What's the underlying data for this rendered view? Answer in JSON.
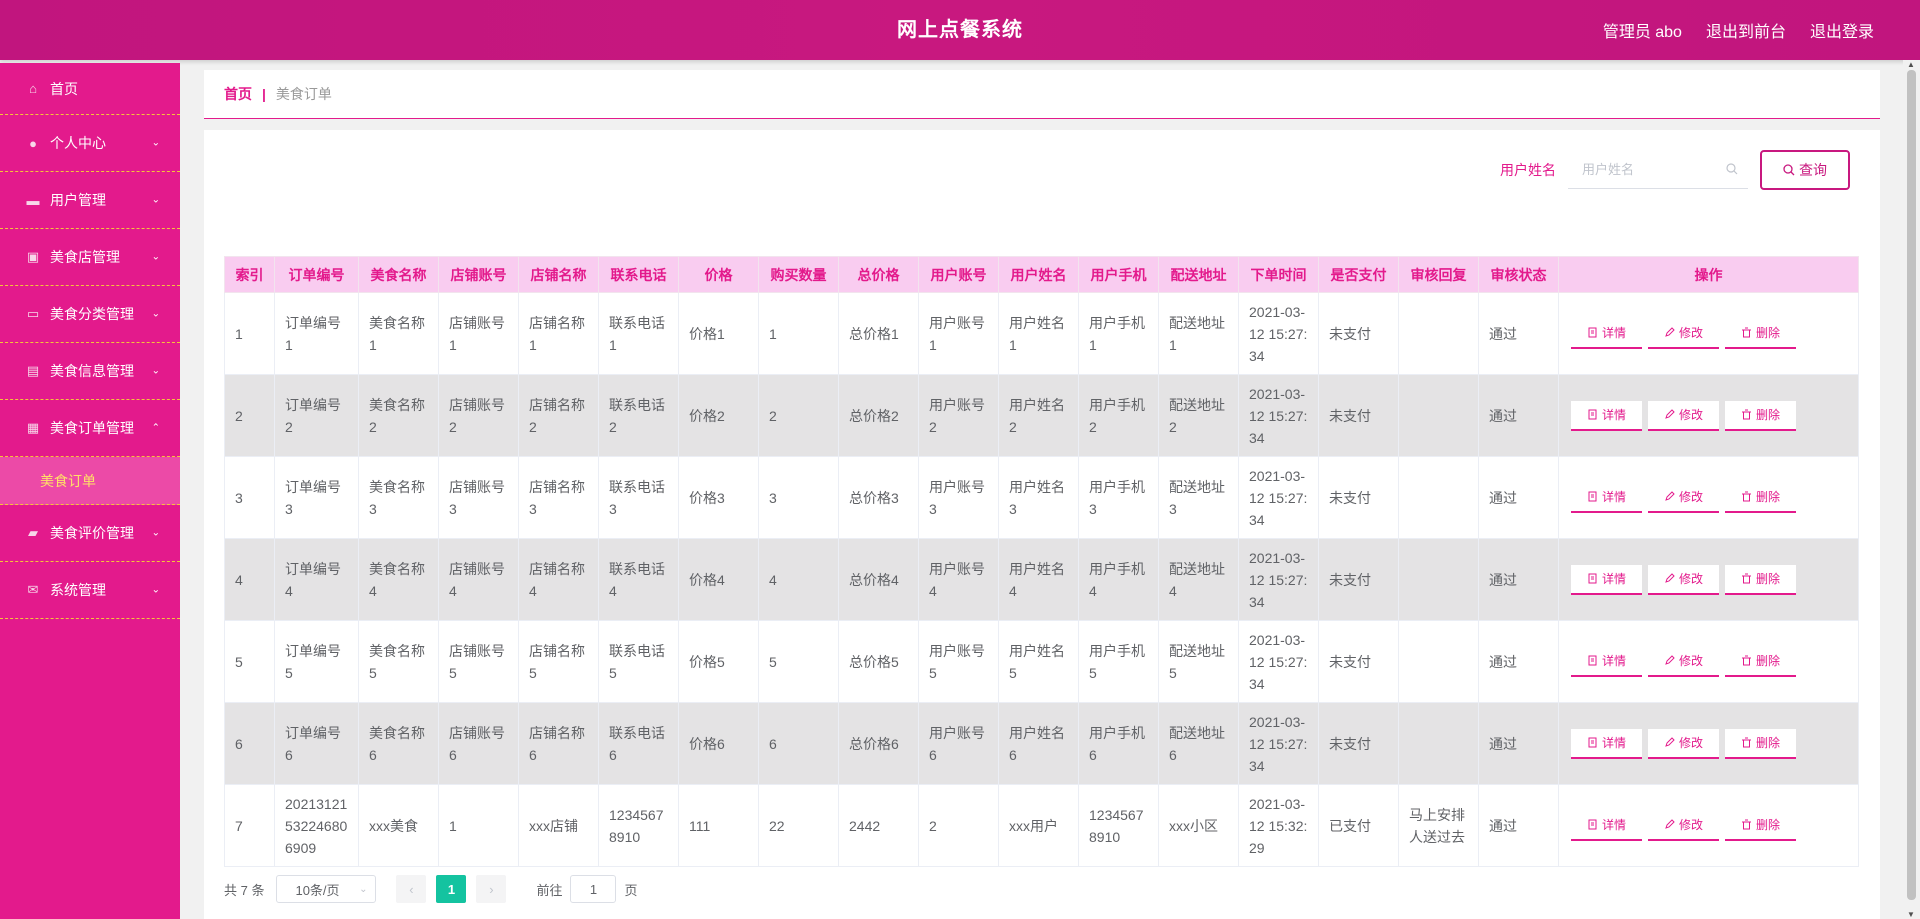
{
  "header": {
    "title": "网上点餐系统",
    "admin_label": "管理员 abo",
    "to_front": "退出到前台",
    "logout": "退出登录"
  },
  "sidebar": {
    "items": [
      {
        "label": "首页",
        "icon": "home-icon"
      },
      {
        "label": "个人中心",
        "icon": "user-icon"
      },
      {
        "label": "用户管理",
        "icon": "users-icon"
      },
      {
        "label": "美食店管理",
        "icon": "store-icon"
      },
      {
        "label": "美食分类管理",
        "icon": "category-icon"
      },
      {
        "label": "美食信息管理",
        "icon": "info-icon"
      },
      {
        "label": "美食订单管理",
        "icon": "order-icon"
      },
      {
        "label": "美食评价管理",
        "icon": "review-icon"
      },
      {
        "label": "系统管理",
        "icon": "system-icon"
      }
    ],
    "submenu_active": "美食订单"
  },
  "breadcrumb": {
    "home": "首页",
    "current": "美食订单"
  },
  "search": {
    "label": "用户姓名",
    "placeholder": "用户姓名",
    "button": "查询"
  },
  "table": {
    "headers": [
      "索引",
      "订单编号",
      "美食名称",
      "店铺账号",
      "店铺名称",
      "联系电话",
      "价格",
      "购买数量",
      "总价格",
      "用户账号",
      "用户姓名",
      "用户手机",
      "配送地址",
      "下单时间",
      "是否支付",
      "审核回复",
      "审核状态",
      "操作"
    ],
    "rows": [
      [
        "1",
        "订单编号1",
        "美食名称1",
        "店铺账号1",
        "店铺名称1",
        "联系电话1",
        "价格1",
        "1",
        "总价格1",
        "用户账号1",
        "用户姓名1",
        "用户手机1",
        "配送地址1",
        "2021-03-12 15:27:34",
        "未支付",
        "",
        "通过"
      ],
      [
        "2",
        "订单编号2",
        "美食名称2",
        "店铺账号2",
        "店铺名称2",
        "联系电话2",
        "价格2",
        "2",
        "总价格2",
        "用户账号2",
        "用户姓名2",
        "用户手机2",
        "配送地址2",
        "2021-03-12 15:27:34",
        "未支付",
        "",
        "通过"
      ],
      [
        "3",
        "订单编号3",
        "美食名称3",
        "店铺账号3",
        "店铺名称3",
        "联系电话3",
        "价格3",
        "3",
        "总价格3",
        "用户账号3",
        "用户姓名3",
        "用户手机3",
        "配送地址3",
        "2021-03-12 15:27:34",
        "未支付",
        "",
        "通过"
      ],
      [
        "4",
        "订单编号4",
        "美食名称4",
        "店铺账号4",
        "店铺名称4",
        "联系电话4",
        "价格4",
        "4",
        "总价格4",
        "用户账号4",
        "用户姓名4",
        "用户手机4",
        "配送地址4",
        "2021-03-12 15:27:34",
        "未支付",
        "",
        "通过"
      ],
      [
        "5",
        "订单编号5",
        "美食名称5",
        "店铺账号5",
        "店铺名称5",
        "联系电话5",
        "价格5",
        "5",
        "总价格5",
        "用户账号5",
        "用户姓名5",
        "用户手机5",
        "配送地址5",
        "2021-03-12 15:27:34",
        "未支付",
        "",
        "通过"
      ],
      [
        "6",
        "订单编号6",
        "美食名称6",
        "店铺账号6",
        "店铺名称6",
        "联系电话6",
        "价格6",
        "6",
        "总价格6",
        "用户账号6",
        "用户姓名6",
        "用户手机6",
        "配送地址6",
        "2021-03-12 15:27:34",
        "未支付",
        "",
        "通过"
      ],
      [
        "7",
        "20213121532246806909",
        "xxx美食",
        "1",
        "xxx店铺",
        "12345678910",
        "111",
        "22",
        "2442",
        "2",
        "xxx用户",
        "12345678910",
        "xxx小区",
        "2021-03-12 15:32:29",
        "已支付",
        "马上安排人送过去",
        "通过"
      ]
    ],
    "ops": {
      "detail": "详情",
      "edit": "修改",
      "delete": "删除"
    }
  },
  "pagination": {
    "total": "共 7 条",
    "page_size": "10条/页",
    "current_page": "1",
    "goto_prefix": "前往",
    "goto_value": "1",
    "goto_suffix": "页"
  },
  "colors": {
    "header": "#c8187f",
    "sidebar": "#e31a8c",
    "accent": "#e31a8c",
    "table_header_bg": "#f9ccf0",
    "pager_active": "#14c3a0"
  }
}
